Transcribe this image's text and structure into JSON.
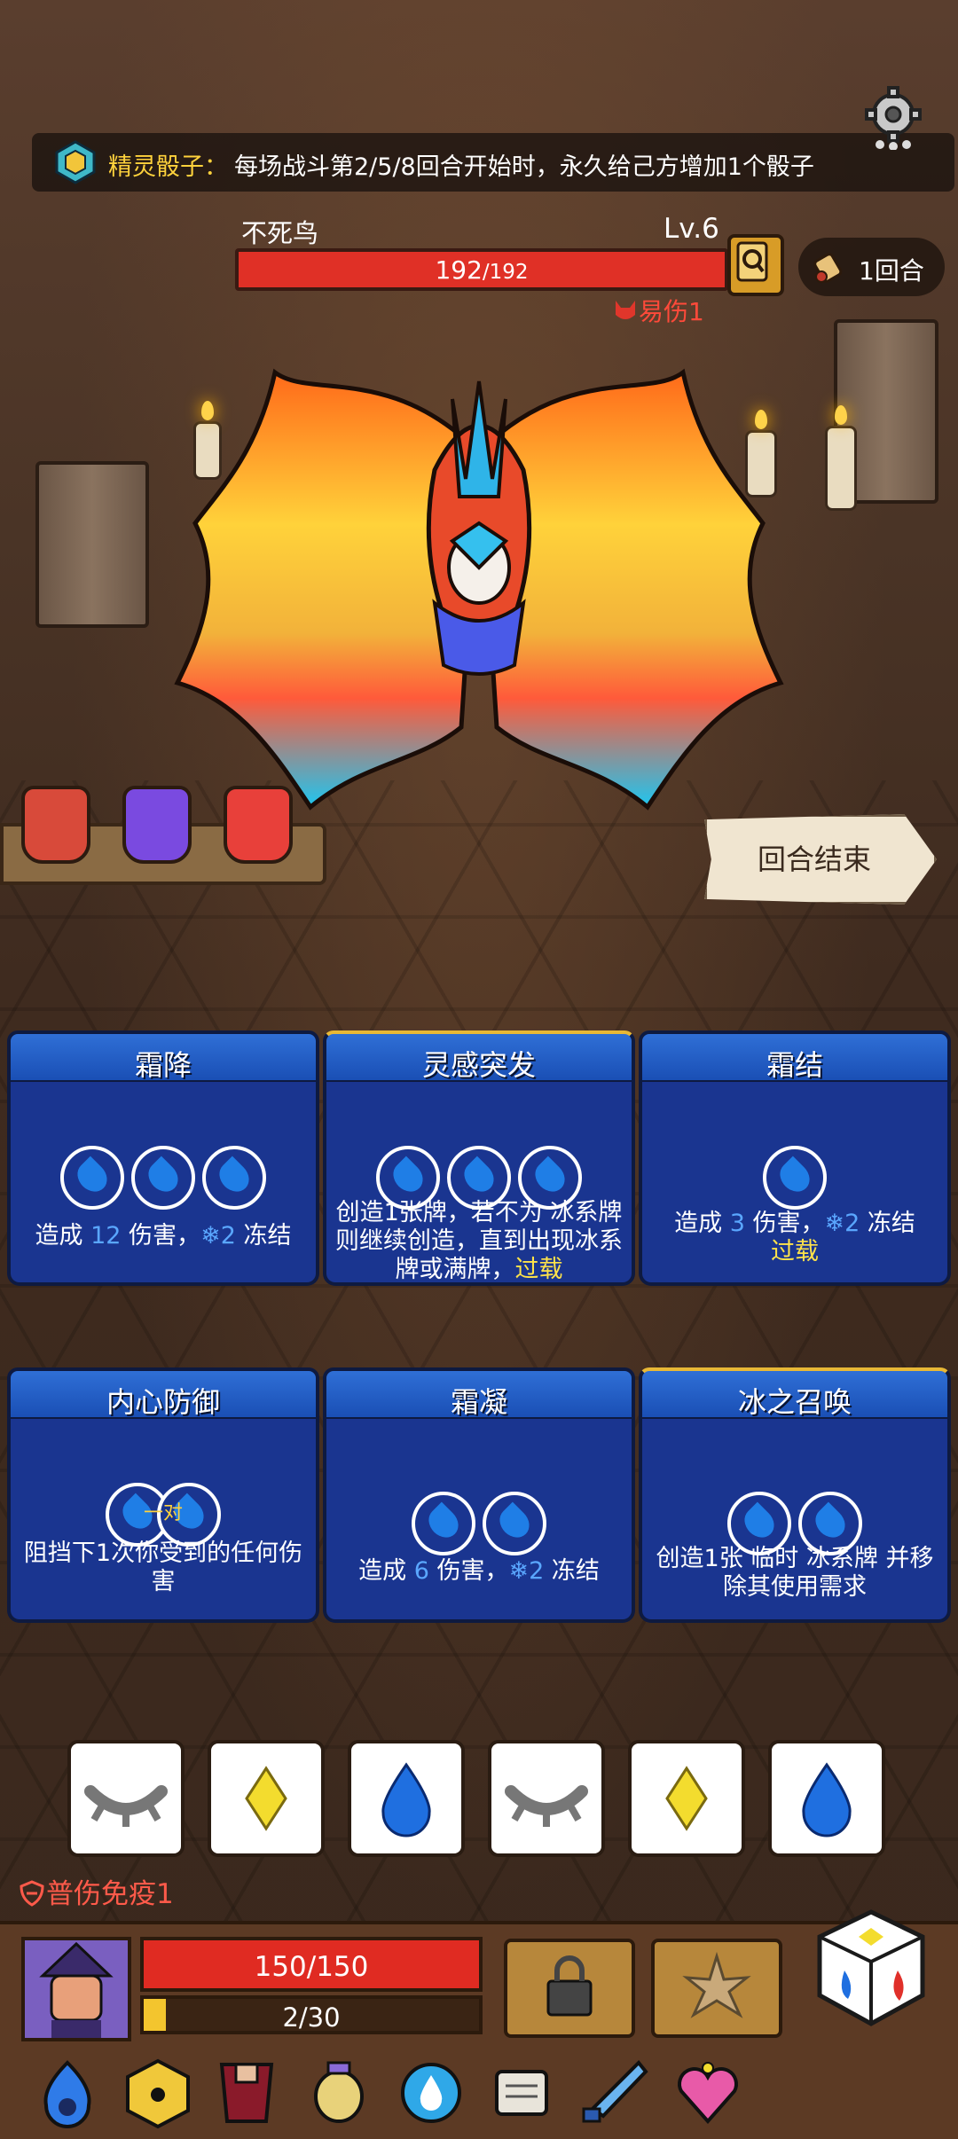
{
  "topbar": {
    "skill_name": "精灵骰子：",
    "skill_desc": "每场战斗第2/5/8回合开始时，永久给己方增加1个骰子",
    "settings_icon": "gear-icon"
  },
  "enemy": {
    "name": "不死鸟",
    "level": "Lv.6",
    "hp_current": "192",
    "hp_max": "/192",
    "status": "易伤1"
  },
  "turn": {
    "label": "1回合"
  },
  "end_turn": {
    "label": "回合结束"
  },
  "cards": [
    {
      "title": "霜降",
      "drops": 3,
      "desc_parts": [
        "造成 ",
        "12",
        " 伤害，",
        "2",
        " 冻结"
      ]
    },
    {
      "title": "灵感突发",
      "drops": 3,
      "desc": "创造1张牌，若不为 冰系牌则继续创造，直到出现冰系牌或满牌，",
      "desc_hl": "过载"
    },
    {
      "title": "霜结",
      "drops": 1,
      "desc_parts": [
        "造成 ",
        "3",
        " 伤害，",
        "2",
        " 冻结"
      ],
      "desc_hl": "过载"
    },
    {
      "title": "内心防御",
      "pair_label": "一对",
      "desc": "阻挡下1次你受到的任何伤害"
    },
    {
      "title": "霜凝",
      "drops": 2,
      "desc_parts": [
        "造成 ",
        "6",
        " 伤害，",
        "2",
        " 冻结"
      ]
    },
    {
      "title": "冰之召唤",
      "drops": 2,
      "desc": "创造1张 临时 冰系牌 并移除其使用需求"
    }
  ],
  "dice": [
    "eye-closed",
    "diamond",
    "water-drop",
    "eye-closed",
    "diamond",
    "water-drop"
  ],
  "player": {
    "immunity": "普伤免疫1",
    "hp": "150/150",
    "xp": "2/30",
    "xp_fraction": 0.067
  },
  "colors": {
    "accent_blue": "#1a3590",
    "hp_red": "#e02b22",
    "gold": "#ffd23c"
  }
}
